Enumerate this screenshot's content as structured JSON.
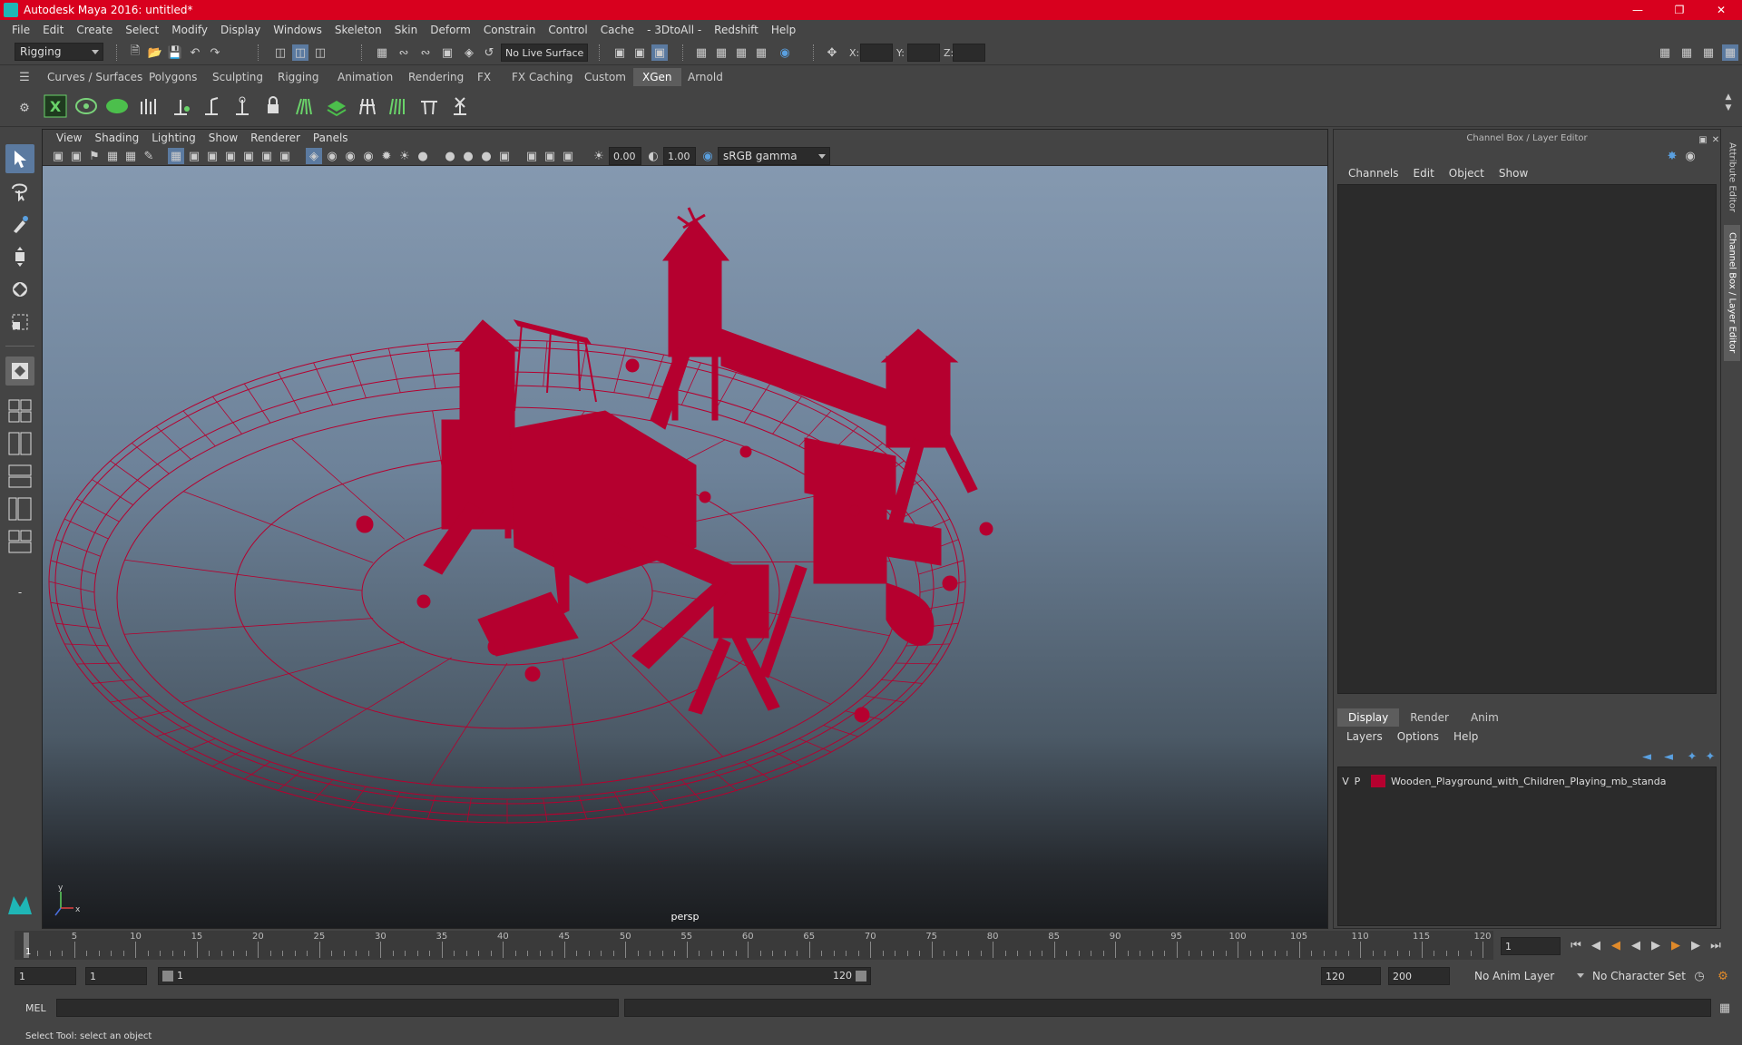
{
  "window": {
    "title": "Autodesk Maya 2016: untitled*"
  },
  "menu": [
    "File",
    "Edit",
    "Create",
    "Select",
    "Modify",
    "Display",
    "Windows",
    "Skeleton",
    "Skin",
    "Deform",
    "Constrain",
    "Control",
    "Cache",
    "- 3DtoAll -",
    "Redshift",
    "Help"
  ],
  "statusline": {
    "menuset": "Rigging",
    "live_surface": "No Live Surface",
    "x_label": "X:",
    "y_label": "Y:",
    "z_label": "Z:"
  },
  "shelf_tabs": [
    "Curves / Surfaces",
    "Polygons",
    "Sculpting",
    "Rigging",
    "Animation",
    "Rendering",
    "FX",
    "FX Caching",
    "Custom",
    "XGen",
    "Arnold"
  ],
  "shelf_active": "XGen",
  "viewport": {
    "menu": [
      "View",
      "Shading",
      "Lighting",
      "Show",
      "Renderer",
      "Panels"
    ],
    "exposure": "0.00",
    "gamma": "1.00",
    "colorspace": "sRGB gamma",
    "camera": "persp",
    "wire_color": "#b5002f"
  },
  "channelbox": {
    "title": "Channel Box / Layer Editor",
    "menu": [
      "Channels",
      "Edit",
      "Object",
      "Show"
    ],
    "layer_tabs": [
      "Display",
      "Render",
      "Anim"
    ],
    "layer_menu": [
      "Layers",
      "Options",
      "Help"
    ],
    "layer": {
      "v": "V",
      "p": "P",
      "name": "Wooden_Playground_with_Children_Playing_mb_standa",
      "color": "#b5002f"
    }
  },
  "side_tabs": [
    "Attribute Editor",
    "Channel Box / Layer Editor"
  ],
  "timeline": {
    "ticks": [
      "5",
      "10",
      "15",
      "20",
      "25",
      "30",
      "35",
      "40",
      "45",
      "50",
      "55",
      "60",
      "65",
      "70",
      "75",
      "80",
      "85",
      "90",
      "95",
      "100",
      "105",
      "110",
      "115",
      "120"
    ],
    "current_marker": "1",
    "current_frame": "1"
  },
  "range": {
    "start": "1",
    "playback_start": "1",
    "slider_start": "1",
    "slider_end": "120",
    "playback_end": "120",
    "end": "200",
    "anim_layer": "No Anim Layer",
    "character_set": "No Character Set"
  },
  "cmdline": {
    "label": "MEL"
  },
  "helpline": {
    "text": "Select Tool: select an object"
  }
}
